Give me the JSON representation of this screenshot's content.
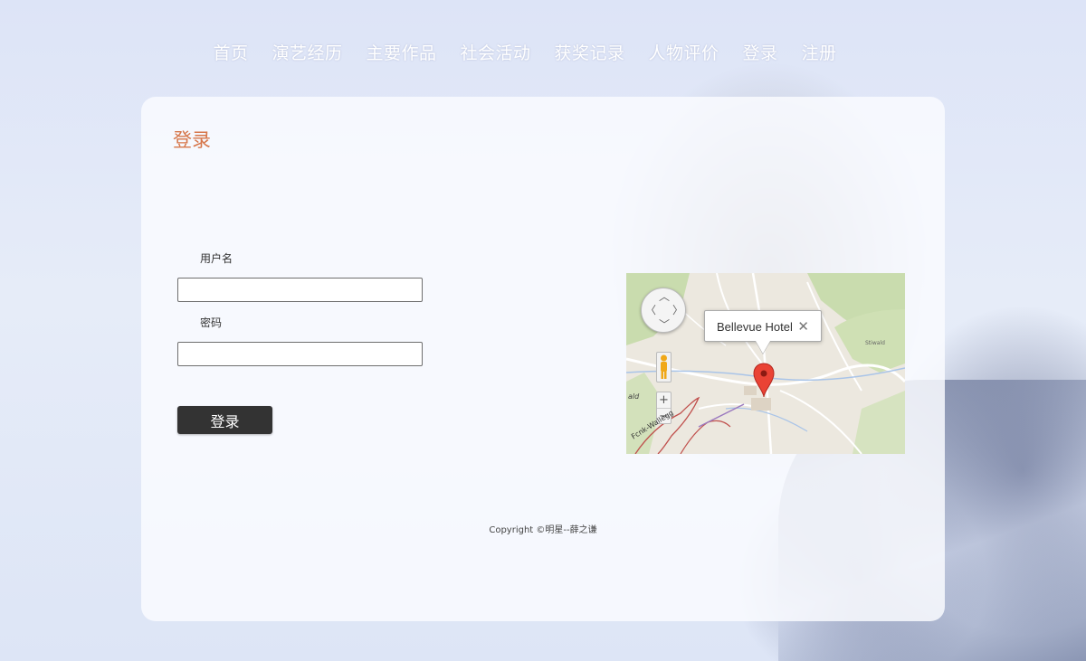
{
  "nav": {
    "items": [
      {
        "label": "首页"
      },
      {
        "label": "演艺经历"
      },
      {
        "label": "主要作品"
      },
      {
        "label": "社会活动"
      },
      {
        "label": "获奖记录"
      },
      {
        "label": "人物评价"
      },
      {
        "label": "登录"
      },
      {
        "label": "注册"
      }
    ]
  },
  "login": {
    "title": "登录",
    "username_label": "用户名",
    "username_value": "",
    "password_label": "密码",
    "password_value": "",
    "submit_label": "登录"
  },
  "map": {
    "info_title": "Bellevue Hotel",
    "close_glyph": "✕",
    "zoom_in": "+",
    "zoom_out": "−",
    "road_label": "Fcnk-Wallegg",
    "place_label_left": "ald",
    "place_label_right": "Stiwald"
  },
  "footer": {
    "copyright": "Copyright ©明星--薛之谦"
  },
  "colors": {
    "title": "#d6764a",
    "button": "#333333"
  }
}
